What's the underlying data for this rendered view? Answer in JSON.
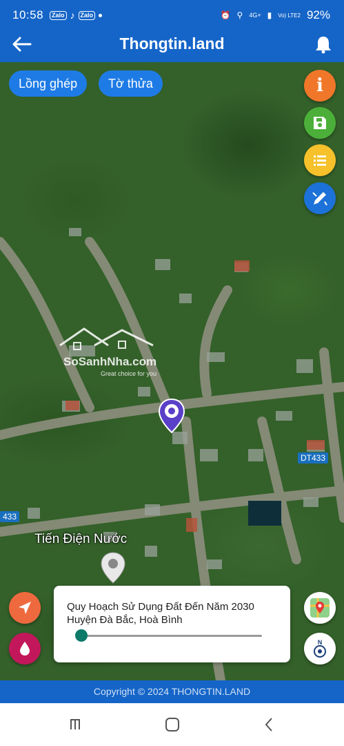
{
  "status_bar": {
    "time": "10:58",
    "notifications": [
      "Zalo",
      "Zalo"
    ],
    "network": "4G+",
    "volte": "Vo) LTE2",
    "battery": "92%"
  },
  "app_bar": {
    "title": "Thongtin.land"
  },
  "map": {
    "chips": [
      "Lồng ghép",
      "Tờ thửa"
    ],
    "place_label": "Tiến Điện Nước",
    "road_labels": [
      "DT433",
      "433"
    ],
    "watermark": {
      "name": "SoSanhNha.com",
      "tagline": "Great choice for you"
    }
  },
  "plan_card": {
    "line1": "Quy Hoạch Sử Dụng Đất Đến Năm 2030",
    "line2": "Huyện Đà Bắc, Hoà Bình",
    "opacity_value": 0
  },
  "footer": {
    "copyright": "Copyright © 2024 THONGTIN.LAND"
  },
  "icons": {
    "info": "info-icon",
    "save": "save-icon",
    "list": "list-icon",
    "draw": "draw-icon",
    "navigate": "navigate-icon",
    "drop": "drop-icon",
    "layers": "map-layers-icon",
    "compass": "compass-icon"
  },
  "colors": {
    "primary": "#1565c8",
    "chip": "#1e7be6",
    "info": "#f0772a",
    "save": "#4caf39",
    "list": "#f6c12a",
    "draw": "#1c72d8",
    "navigate": "#ee6a3e",
    "drop": "#c2185b",
    "slider": "#0d7a6a"
  }
}
